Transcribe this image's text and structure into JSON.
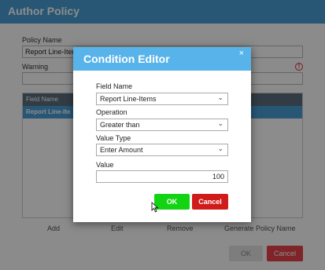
{
  "background": {
    "title": "Author Policy",
    "policy_name_label": "Policy Name",
    "policy_name_value": "Report Line-Item",
    "warning_label": "Warning",
    "grid_header_field": "Field Name",
    "grid_row_value": "Report Line-Ite",
    "actions": [
      "Add",
      "Edit",
      "Remove",
      "Generate Policy Name"
    ],
    "ok_label": "OK",
    "cancel_label": "Cancel"
  },
  "dialog": {
    "title": "Condition Editor",
    "close_symbol": "×",
    "field_name_label": "Field Name",
    "field_name_value": "Report Line-Items",
    "operation_label": "Operation",
    "operation_value": "Greater than",
    "value_type_label": "Value Type",
    "value_type_value": "Enter Amount",
    "value_label": "Value",
    "value_value": "100",
    "ok_label": "OK",
    "cancel_label": "Cancel"
  },
  "colors": {
    "dialog_header": "#58b3ea",
    "ok_button": "#13d413",
    "cancel_button": "#d11b1b"
  },
  "icons": {
    "dropdown": "chevron-down-icon",
    "warning": "alert-circle-icon",
    "cursor": "mouse-pointer-icon"
  }
}
